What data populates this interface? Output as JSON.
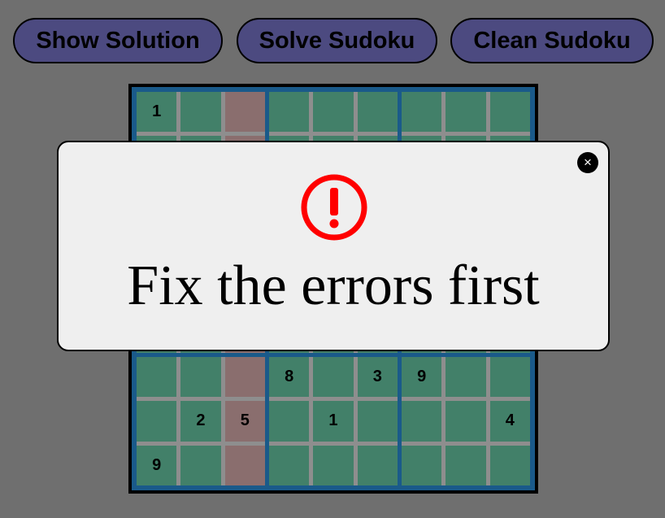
{
  "toolbar": {
    "show_solution_label": "Show Solution",
    "solve_label": "Solve Sudoku",
    "clean_label": "Clean Sudoku"
  },
  "board": {
    "highlighted_column": 2,
    "rows": [
      [
        "1",
        "",
        "",
        "",
        "",
        "",
        "",
        "",
        ""
      ],
      [
        "",
        "",
        "",
        "",
        "",
        "",
        "",
        "",
        ""
      ],
      [
        "",
        "",
        "",
        "",
        "",
        "",
        "",
        "",
        ""
      ],
      [
        "",
        "",
        "",
        "",
        "",
        "",
        "",
        "",
        ""
      ],
      [
        "",
        "",
        "",
        "",
        "",
        "",
        "",
        "",
        ""
      ],
      [
        "",
        "",
        "",
        "",
        "",
        "",
        "",
        "",
        ""
      ],
      [
        "",
        "",
        "",
        "8",
        "",
        "3",
        "9",
        "",
        ""
      ],
      [
        "",
        "2",
        "5",
        "",
        "1",
        "",
        "",
        "",
        "4"
      ],
      [
        "9",
        "",
        "",
        "",
        "",
        "",
        "",
        "",
        ""
      ]
    ]
  },
  "modal": {
    "message": "Fix the errors first",
    "close_symbol": "×",
    "icon": "exclamation-circle-icon",
    "accent_color": "#ff0000"
  },
  "colors": {
    "background": "#6f6f6f",
    "button": "#4c4a80",
    "cell": "#428069",
    "cell_highlight": "#8a6e6e",
    "box_border": "#1a5a8a",
    "modal_bg": "#efefef"
  }
}
